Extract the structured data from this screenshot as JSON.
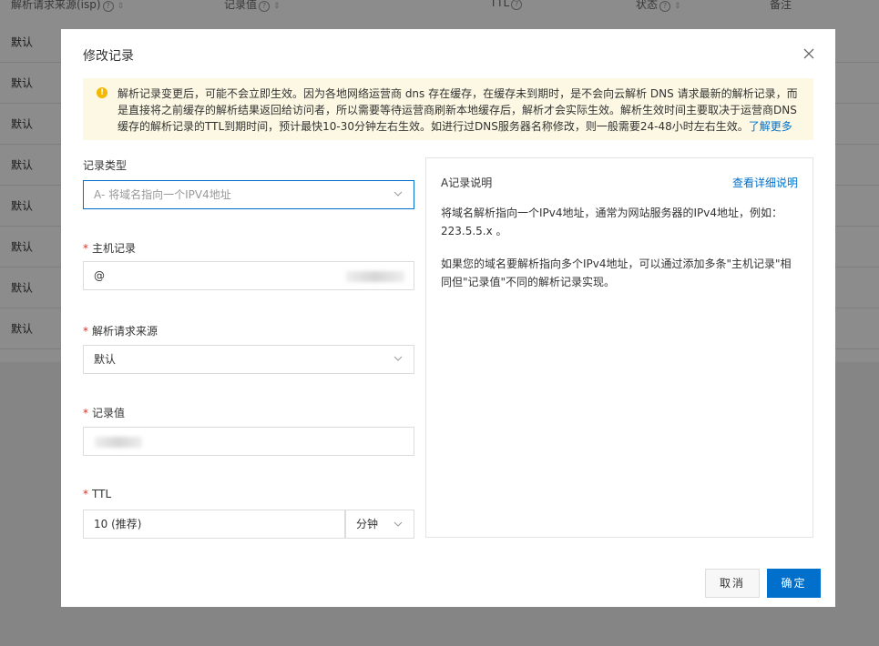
{
  "background_table": {
    "headers": [
      {
        "label": "解析请求来源(isp)"
      },
      {
        "label": "记录值"
      },
      {
        "label": "TTL"
      },
      {
        "label": "状态"
      },
      {
        "label": "备注"
      }
    ],
    "rows": [
      "默认",
      "默认",
      "默认",
      "默认",
      "默认",
      "默认",
      "默认",
      "默认"
    ]
  },
  "modal": {
    "title": "修改记录",
    "notice": {
      "text": "解析记录变更后，可能不会立即生效。因为各地网络运营商 dns 存在缓存，在缓存未到期时，是不会向云解析 DNS 请求最新的解析记录，而是直接将之前缓存的解析结果返回给访问者，所以需要等待运营商刷新本地缓存后，解析才会实际生效。解析生效时间主要取决于运营商DNS缓存的解析记录的TTL到期时间，预计最快10-30分钟左右生效。如进行过DNS服务器名称修改，则一般需要24-48小时左右生效。",
      "link": "了解更多"
    },
    "form": {
      "record_type": {
        "label": "记录类型",
        "value": "A- 将域名指向一个IPV4地址"
      },
      "host": {
        "label": "主机记录",
        "value": "@"
      },
      "source": {
        "label": "解析请求来源",
        "value": "默认"
      },
      "record_value": {
        "label": "记录值",
        "value": ""
      },
      "ttl": {
        "label": "TTL",
        "value": "10 (推荐)",
        "unit": "分钟"
      }
    },
    "info": {
      "title": "A记录说明",
      "link": "查看详细说明",
      "paragraph1": "将域名解析指向一个IPv4地址，通常为网站服务器的IPv4地址，例如：223.5.5.x 。",
      "paragraph2": "如果您的域名要解析指向多个IPv4地址，可以通过添加多条\"主机记录\"相同但\"记录值\"不同的解析记录实现。"
    },
    "buttons": {
      "cancel": "取消",
      "ok": "确定"
    }
  }
}
